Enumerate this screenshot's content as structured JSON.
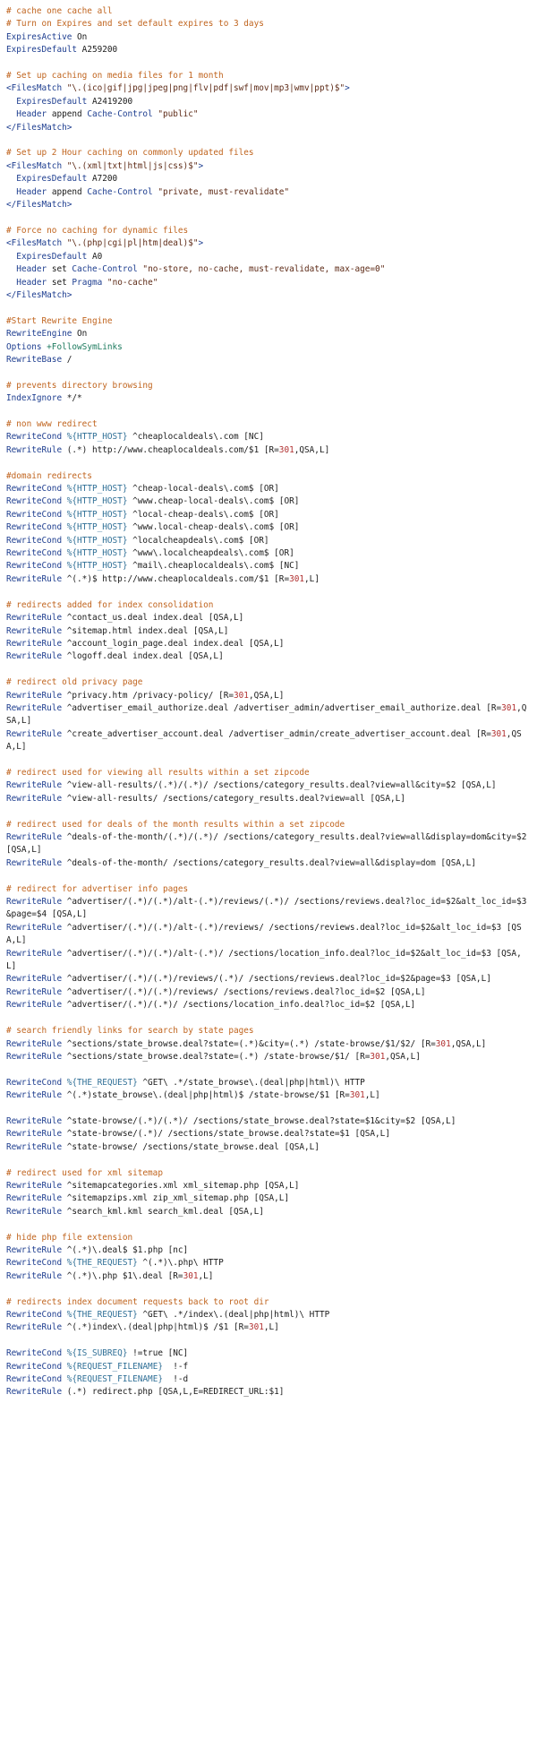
{
  "lines": [
    [
      [
        "c",
        "# cache one cache all"
      ]
    ],
    [
      [
        "c",
        "# Turn on Expires and set default expires to 3 days"
      ]
    ],
    [
      [
        "d",
        "ExpiresActive"
      ],
      [
        "t",
        " On"
      ]
    ],
    [
      [
        "d",
        "ExpiresDefault"
      ],
      [
        "t",
        " A259200"
      ]
    ],
    [],
    [
      [
        "c",
        "# Set up caching on media files for 1 month"
      ]
    ],
    [
      [
        "d",
        "<FilesMatch"
      ],
      [
        "s",
        " \"\\.(ico|gif|jpg|jpeg|png|flv|pdf|swf|mov|mp3|wmv|ppt)$\""
      ],
      [
        "d",
        ">"
      ]
    ],
    [
      [
        "t",
        "  "
      ],
      [
        "d",
        "ExpiresDefault"
      ],
      [
        "t",
        " A2419200"
      ]
    ],
    [
      [
        "t",
        "  "
      ],
      [
        "d",
        "Header"
      ],
      [
        "t",
        " append "
      ],
      [
        "d",
        "Cache-Control"
      ],
      [
        "s",
        " \"public\""
      ]
    ],
    [
      [
        "d",
        "</FilesMatch>"
      ]
    ],
    [],
    [
      [
        "c",
        "# Set up 2 Hour caching on commonly updated files"
      ]
    ],
    [
      [
        "d",
        "<FilesMatch"
      ],
      [
        "s",
        " \"\\.(xml|txt|html|js|css)$\""
      ],
      [
        "d",
        ">"
      ]
    ],
    [
      [
        "t",
        "  "
      ],
      [
        "d",
        "ExpiresDefault"
      ],
      [
        "t",
        " A7200"
      ]
    ],
    [
      [
        "t",
        "  "
      ],
      [
        "d",
        "Header"
      ],
      [
        "t",
        " append "
      ],
      [
        "d",
        "Cache-Control"
      ],
      [
        "s",
        " \"private, must-revalidate\""
      ]
    ],
    [
      [
        "d",
        "</FilesMatch>"
      ]
    ],
    [],
    [
      [
        "c",
        "# Force no caching for dynamic files"
      ]
    ],
    [
      [
        "d",
        "<FilesMatch"
      ],
      [
        "s",
        " \"\\.(php|cgi|pl|htm|deal)$\""
      ],
      [
        "d",
        ">"
      ]
    ],
    [
      [
        "t",
        "  "
      ],
      [
        "d",
        "ExpiresDefault"
      ],
      [
        "t",
        " A0"
      ]
    ],
    [
      [
        "t",
        "  "
      ],
      [
        "d",
        "Header"
      ],
      [
        "t",
        " set "
      ],
      [
        "d",
        "Cache-Control"
      ],
      [
        "s",
        " \"no-store, no-cache, must-revalidate, max-age=0\""
      ]
    ],
    [
      [
        "t",
        "  "
      ],
      [
        "d",
        "Header"
      ],
      [
        "t",
        " set "
      ],
      [
        "d",
        "Pragma"
      ],
      [
        "s",
        " \"no-cache\""
      ]
    ],
    [
      [
        "d",
        "</FilesMatch>"
      ]
    ],
    [],
    [
      [
        "c",
        "#Start Rewrite Engine"
      ]
    ],
    [
      [
        "d",
        "RewriteEngine"
      ],
      [
        "t",
        " On"
      ]
    ],
    [
      [
        "d",
        "Options"
      ],
      [
        "g",
        " +FollowSymLinks"
      ]
    ],
    [
      [
        "d",
        "RewriteBase"
      ],
      [
        "t",
        " /"
      ]
    ],
    [],
    [
      [
        "c",
        "# prevents directory browsing"
      ]
    ],
    [
      [
        "d",
        "IndexIgnore"
      ],
      [
        "t",
        " */*"
      ]
    ],
    [],
    [
      [
        "c",
        "# non www redirect"
      ]
    ],
    [
      [
        "d",
        "RewriteCond"
      ],
      [
        "v",
        " %{HTTP_HOST}"
      ],
      [
        "t",
        " ^cheaplocaldeals\\.com [NC]"
      ]
    ],
    [
      [
        "d",
        "RewriteRule"
      ],
      [
        "t",
        " (.*) http://www.cheaplocaldeals.com/$1 [R="
      ],
      [
        "n",
        "301"
      ],
      [
        "t",
        ",QSA,L]"
      ]
    ],
    [],
    [
      [
        "c",
        "#domain redirects"
      ]
    ],
    [
      [
        "d",
        "RewriteCond"
      ],
      [
        "v",
        " %{HTTP_HOST}"
      ],
      [
        "t",
        " ^cheap-local-deals\\.com$ [OR]"
      ]
    ],
    [
      [
        "d",
        "RewriteCond"
      ],
      [
        "v",
        " %{HTTP_HOST}"
      ],
      [
        "t",
        " ^www.cheap-local-deals\\.com$ [OR]"
      ]
    ],
    [
      [
        "d",
        "RewriteCond"
      ],
      [
        "v",
        " %{HTTP_HOST}"
      ],
      [
        "t",
        " ^local-cheap-deals\\.com$ [OR]"
      ]
    ],
    [
      [
        "d",
        "RewriteCond"
      ],
      [
        "v",
        " %{HTTP_HOST}"
      ],
      [
        "t",
        " ^www.local-cheap-deals\\.com$ [OR]"
      ]
    ],
    [
      [
        "d",
        "RewriteCond"
      ],
      [
        "v",
        " %{HTTP_HOST}"
      ],
      [
        "t",
        " ^localcheapdeals\\.com$ [OR]"
      ]
    ],
    [
      [
        "d",
        "RewriteCond"
      ],
      [
        "v",
        " %{HTTP_HOST}"
      ],
      [
        "t",
        " ^www\\.localcheapdeals\\.com$ [OR]"
      ]
    ],
    [
      [
        "d",
        "RewriteCond"
      ],
      [
        "v",
        " %{HTTP_HOST}"
      ],
      [
        "t",
        " ^mail\\.cheaplocaldeals\\.com$ [NC]"
      ]
    ],
    [
      [
        "d",
        "RewriteRule"
      ],
      [
        "t",
        " ^(.*)$ http://www.cheaplocaldeals.com/$1 [R="
      ],
      [
        "n",
        "301"
      ],
      [
        "t",
        ",L]"
      ]
    ],
    [],
    [
      [
        "c",
        "# redirects added for index consolidation"
      ]
    ],
    [
      [
        "d",
        "RewriteRule"
      ],
      [
        "t",
        " ^contact_us.deal index.deal [QSA,L]"
      ]
    ],
    [
      [
        "d",
        "RewriteRule"
      ],
      [
        "t",
        " ^sitemap.html index.deal [QSA,L]"
      ]
    ],
    [
      [
        "d",
        "RewriteRule"
      ],
      [
        "t",
        " ^account_login_page.deal index.deal [QSA,L]"
      ]
    ],
    [
      [
        "d",
        "RewriteRule"
      ],
      [
        "t",
        " ^logoff.deal index.deal [QSA,L]"
      ]
    ],
    [],
    [
      [
        "c",
        "# redirect old privacy page"
      ]
    ],
    [
      [
        "d",
        "RewriteRule"
      ],
      [
        "t",
        " ^privacy.htm /privacy-policy/ [R="
      ],
      [
        "n",
        "301"
      ],
      [
        "t",
        ",QSA,L]"
      ]
    ],
    [
      [
        "d",
        "RewriteRule"
      ],
      [
        "t",
        " ^advertiser_email_authorize.deal /advertiser_admin/advertiser_email_authorize.deal [R="
      ],
      [
        "n",
        "301"
      ],
      [
        "t",
        ",QSA,L]"
      ]
    ],
    [
      [
        "d",
        "RewriteRule"
      ],
      [
        "t",
        " ^create_advertiser_account.deal /advertiser_admin/create_advertiser_account.deal [R="
      ],
      [
        "n",
        "301"
      ],
      [
        "t",
        ",QSA,L]"
      ]
    ],
    [],
    [
      [
        "c",
        "# redirect used for viewing all results within a set zipcode"
      ]
    ],
    [
      [
        "d",
        "RewriteRule"
      ],
      [
        "t",
        " ^view-all-results/(.*)/(.*)/ /sections/category_results.deal?view=all&city=$2 [QSA,L]"
      ]
    ],
    [
      [
        "d",
        "RewriteRule"
      ],
      [
        "t",
        " ^view-all-results/ /sections/category_results.deal?view=all [QSA,L]"
      ]
    ],
    [],
    [
      [
        "c",
        "# redirect used for deals of the month results within a set zipcode"
      ]
    ],
    [
      [
        "d",
        "RewriteRule"
      ],
      [
        "t",
        " ^deals-of-the-month/(.*)/(.*)/ /sections/category_results.deal?view=all&display=dom&city=$2 [QSA,L]"
      ]
    ],
    [
      [
        "d",
        "RewriteRule"
      ],
      [
        "t",
        " ^deals-of-the-month/ /sections/category_results.deal?view=all&display=dom [QSA,L]"
      ]
    ],
    [],
    [
      [
        "c",
        "# redirect for advertiser info pages"
      ]
    ],
    [
      [
        "d",
        "RewriteRule"
      ],
      [
        "t",
        " ^advertiser/(.*)/(.*)/alt-(.*)/reviews/(.*)/ /sections/reviews.deal?loc_id=$2&alt_loc_id=$3&page=$4 [QSA,L]"
      ]
    ],
    [
      [
        "d",
        "RewriteRule"
      ],
      [
        "t",
        " ^advertiser/(.*)/(.*)/alt-(.*)/reviews/ /sections/reviews.deal?loc_id=$2&alt_loc_id=$3 [QSA,L]"
      ]
    ],
    [
      [
        "d",
        "RewriteRule"
      ],
      [
        "t",
        " ^advertiser/(.*)/(.*)/alt-(.*)/ /sections/location_info.deal?loc_id=$2&alt_loc_id=$3 [QSA,L]"
      ]
    ],
    [
      [
        "d",
        "RewriteRule"
      ],
      [
        "t",
        " ^advertiser/(.*)/(.*)/reviews/(.*)/ /sections/reviews.deal?loc_id=$2&page=$3 [QSA,L]"
      ]
    ],
    [
      [
        "d",
        "RewriteRule"
      ],
      [
        "t",
        " ^advertiser/(.*)/(.*)/reviews/ /sections/reviews.deal?loc_id=$2 [QSA,L]"
      ]
    ],
    [
      [
        "d",
        "RewriteRule"
      ],
      [
        "t",
        " ^advertiser/(.*)/(.*)/ /sections/location_info.deal?loc_id=$2 [QSA,L]"
      ]
    ],
    [],
    [
      [
        "c",
        "# search friendly links for search by state pages"
      ]
    ],
    [
      [
        "d",
        "RewriteRule"
      ],
      [
        "t",
        " ^sections/state_browse.deal?state=(.*)&city=(.*) /state-browse/$1/$2/ [R="
      ],
      [
        "n",
        "301"
      ],
      [
        "t",
        ",QSA,L]"
      ]
    ],
    [
      [
        "d",
        "RewriteRule"
      ],
      [
        "t",
        " ^sections/state_browse.deal?state=(.*) /state-browse/$1/ [R="
      ],
      [
        "n",
        "301"
      ],
      [
        "t",
        ",QSA,L]"
      ]
    ],
    [],
    [
      [
        "d",
        "RewriteCond"
      ],
      [
        "v",
        " %{THE_REQUEST}"
      ],
      [
        "t",
        " ^GET\\ .*/state_browse\\.(deal|php|html)\\ HTTP"
      ]
    ],
    [
      [
        "d",
        "RewriteRule"
      ],
      [
        "t",
        " ^(.*)state_browse\\.(deal|php|html)$ /state-browse/$1 [R="
      ],
      [
        "n",
        "301"
      ],
      [
        "t",
        ",L]"
      ]
    ],
    [],
    [
      [
        "d",
        "RewriteRule"
      ],
      [
        "t",
        " ^state-browse/(.*)/(.*)/ /sections/state_browse.deal?state=$1&city=$2 [QSA,L]"
      ]
    ],
    [
      [
        "d",
        "RewriteRule"
      ],
      [
        "t",
        " ^state-browse/(.*)/ /sections/state_browse.deal?state=$1 [QSA,L]"
      ]
    ],
    [
      [
        "d",
        "RewriteRule"
      ],
      [
        "t",
        " ^state-browse/ /sections/state_browse.deal [QSA,L]"
      ]
    ],
    [],
    [
      [
        "c",
        "# redirect used for xml sitemap"
      ]
    ],
    [
      [
        "d",
        "RewriteRule"
      ],
      [
        "t",
        " ^sitemapcategories.xml xml_sitemap.php [QSA,L]"
      ]
    ],
    [
      [
        "d",
        "RewriteRule"
      ],
      [
        "t",
        " ^sitemapzips.xml zip_xml_sitemap.php [QSA,L]"
      ]
    ],
    [
      [
        "d",
        "RewriteRule"
      ],
      [
        "t",
        " ^search_kml.kml search_kml.deal [QSA,L]"
      ]
    ],
    [],
    [
      [
        "c",
        "# hide php file extension"
      ]
    ],
    [
      [
        "d",
        "RewriteRule"
      ],
      [
        "t",
        " ^(.*)\\.deal$ $1.php [nc]"
      ]
    ],
    [
      [
        "d",
        "RewriteCond"
      ],
      [
        "v",
        " %{THE_REQUEST}"
      ],
      [
        "t",
        " ^(.*)\\.php\\ HTTP"
      ]
    ],
    [
      [
        "d",
        "RewriteRule"
      ],
      [
        "t",
        " ^(.*)\\.php $1\\.deal [R="
      ],
      [
        "n",
        "301"
      ],
      [
        "t",
        ",L]"
      ]
    ],
    [],
    [
      [
        "c",
        "# redirects index document requests back to root dir"
      ]
    ],
    [
      [
        "d",
        "RewriteCond"
      ],
      [
        "v",
        " %{THE_REQUEST}"
      ],
      [
        "t",
        " ^GET\\ .*/index\\.(deal|php|html)\\ HTTP"
      ]
    ],
    [
      [
        "d",
        "RewriteRule"
      ],
      [
        "t",
        " ^(.*)index\\.(deal|php|html)$ /$1 [R="
      ],
      [
        "n",
        "301"
      ],
      [
        "t",
        ",L]"
      ]
    ],
    [],
    [
      [
        "d",
        "RewriteCond"
      ],
      [
        "v",
        " %{IS_SUBREQ}"
      ],
      [
        "t",
        " !=true [NC]"
      ]
    ],
    [
      [
        "d",
        "RewriteCond"
      ],
      [
        "v",
        " %{REQUEST_FILENAME}"
      ],
      [
        "t",
        "  !-f"
      ]
    ],
    [
      [
        "d",
        "RewriteCond"
      ],
      [
        "v",
        " %{REQUEST_FILENAME}"
      ],
      [
        "t",
        "  !-d"
      ]
    ],
    [
      [
        "d",
        "RewriteRule"
      ],
      [
        "t",
        " (.*) redirect.php [QSA,L,E=REDIRECT_URL:$1]"
      ]
    ]
  ],
  "colors": {
    "comment": "#c0641e",
    "directive": "#1d3d8f",
    "string": "#5d2a16",
    "variable": "#2f6f96",
    "number": "#b03030",
    "option": "#1c7a5e",
    "text": "#1a1a1a"
  }
}
